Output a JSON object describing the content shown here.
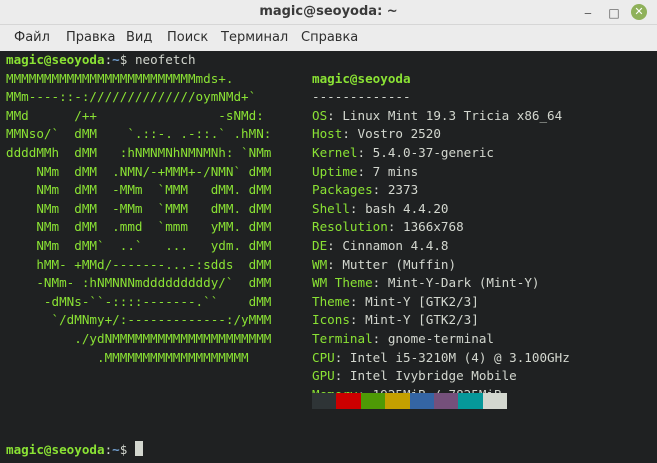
{
  "window": {
    "title": "magic@seoyoda: ~",
    "minimize": "‒",
    "maximize": "□",
    "close": "✕"
  },
  "menu": {
    "items": [
      "Файл",
      "Правка",
      "Вид",
      "Поиск",
      "Терминал",
      "Справка"
    ]
  },
  "prompt": {
    "user_host": "magic@seoyoda",
    "sep": ":",
    "path": "~",
    "dollar": "$ ",
    "command": "neofetch"
  },
  "logo_lines": [
    "MMMMMMMMMMMMMMMMMMMMMMMMMmds+.",
    "MMm----::-://////////////oymNMd+`",
    "MMd      /++                -sNMd:",
    "MMNso/`  dMM    `.::-. .-::.` .hMN:",
    "ddddMMh  dMM   :hNMNMNhNMNMNh: `NMm",
    "    NMm  dMM  .NMN/-+MMM+-/NMN` dMM",
    "    NMm  dMM  -MMm  `MMM   dMM. dMM",
    "    NMm  dMM  -MMm  `MMM   dMM. dMM",
    "    NMm  dMM  .mmd  `mmm   yMM. dMM",
    "    NMm  dMM`  ..`   ...   ydm. dMM",
    "    hMM- +MMd/-------...-:sdds  dMM",
    "    -NMm- :hNMNNNmdddddddddy/`  dMM",
    "     -dMNs-``-::::-------.``    dMM",
    "      `/dMNmy+/:-------------:/yMMM",
    "         ./ydNMMMMMMMMMMMMMMMMMMMMM",
    "            .MMMMMMMMMMMMMMMMMMM"
  ],
  "info": {
    "header": "magic@seoyoda",
    "divider": "-------------",
    "rows": [
      {
        "key": "OS",
        "value": "Linux Mint 19.3 Tricia x86_64"
      },
      {
        "key": "Host",
        "value": "Vostro 2520"
      },
      {
        "key": "Kernel",
        "value": "5.4.0-37-generic"
      },
      {
        "key": "Uptime",
        "value": "7 mins"
      },
      {
        "key": "Packages",
        "value": "2373"
      },
      {
        "key": "Shell",
        "value": "bash 4.4.20"
      },
      {
        "key": "Resolution",
        "value": "1366x768"
      },
      {
        "key": "DE",
        "value": "Cinnamon 4.4.8"
      },
      {
        "key": "WM",
        "value": "Mutter (Muffin)"
      },
      {
        "key": "WM Theme",
        "value": "Mint-Y-Dark (Mint-Y)"
      },
      {
        "key": "Theme",
        "value": "Mint-Y [GTK2/3]"
      },
      {
        "key": "Icons",
        "value": "Mint-Y [GTK2/3]"
      },
      {
        "key": "Terminal",
        "value": "gnome-terminal"
      },
      {
        "key": "CPU",
        "value": "Intel i5-3210M (4) @ 3.100GHz"
      },
      {
        "key": "GPU",
        "value": "Intel Ivybridge Mobile"
      },
      {
        "key": "Memory",
        "value": "1925MiB / 7825MiB"
      }
    ],
    "colon": ": "
  },
  "palette": [
    "#2e3436",
    "#cc0000",
    "#4e9a06",
    "#c4a000",
    "#3465a4",
    "#75507b",
    "#06989a",
    "#d3d7cf"
  ],
  "colors": {
    "accent_green": "#8ae234",
    "prompt_blue": "#729fcf",
    "text": "#d3d7cf",
    "background": "#1f2122"
  }
}
